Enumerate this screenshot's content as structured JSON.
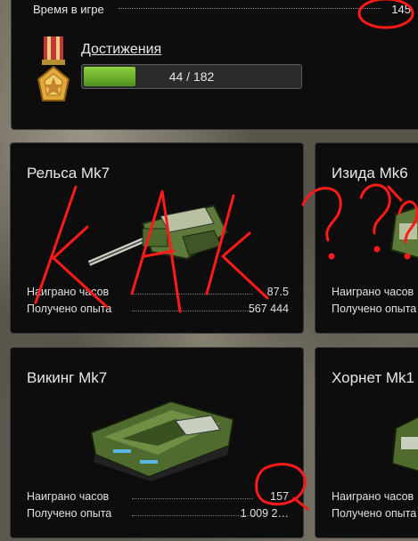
{
  "profile": {
    "time_label": "Время в игре",
    "time_value": "145"
  },
  "achievements": {
    "title": "Достижения",
    "progress_text": "44 / 182",
    "progress_fraction": 0.242
  },
  "cards": [
    {
      "name": "Рельса Mk7",
      "hours_label": "Наиграно часов",
      "hours_value": "87.5",
      "xp_label": "Получено опыта",
      "xp_value": "567 444"
    },
    {
      "name": "Изида Mk6",
      "hours_label": "Наиграно часов",
      "hours_value": "",
      "xp_label": "Получено опыта",
      "xp_value": ""
    },
    {
      "name": "Викинг Mk7",
      "hours_label": "Наиграно часов",
      "hours_value": "157",
      "xp_label": "Получено опыта",
      "xp_value": "1 009 2…"
    },
    {
      "name": "Хорнет Mk1",
      "hours_label": "Наиграно часов",
      "hours_value": "",
      "xp_label": "Получено опыта",
      "xp_value": ""
    }
  ],
  "annotation": {
    "text": "КАК ???",
    "color": "#ff1a1a"
  }
}
